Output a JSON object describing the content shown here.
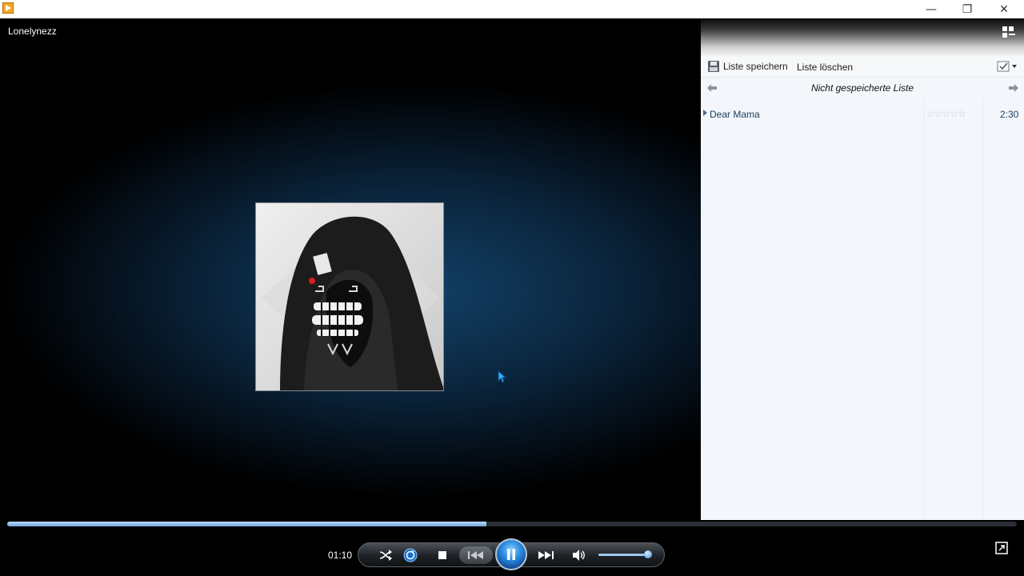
{
  "window": {
    "minimize_glyph": "—",
    "maximize_glyph": "❐",
    "close_glyph": "✕"
  },
  "now_playing": {
    "title": "Lonelynezz",
    "elapsed": "01:10",
    "progress": 0.475,
    "volume": 0.9
  },
  "playlist": {
    "save_label": "Liste speichern",
    "clear_label": "Liste löschen",
    "list_name": "Nicht gespeicherte Liste",
    "items": [
      {
        "title": "Dear Mama",
        "rating": "☆☆☆☆☆",
        "duration": "2:30"
      }
    ]
  },
  "colors": {
    "accent": "#2b8be0",
    "video_bg": "#0b2740",
    "panel_bg": "#f3f7fb"
  },
  "icons": [
    "media-player-icon",
    "switch-layout-icon",
    "save-icon",
    "list-options-icon",
    "back-arrow-icon",
    "forward-arrow-icon",
    "shuffle-icon",
    "repeat-icon",
    "stop-icon",
    "previous-icon",
    "pause-icon",
    "next-icon",
    "volume-icon",
    "fullscreen-icon",
    "mouse-cursor-icon"
  ]
}
